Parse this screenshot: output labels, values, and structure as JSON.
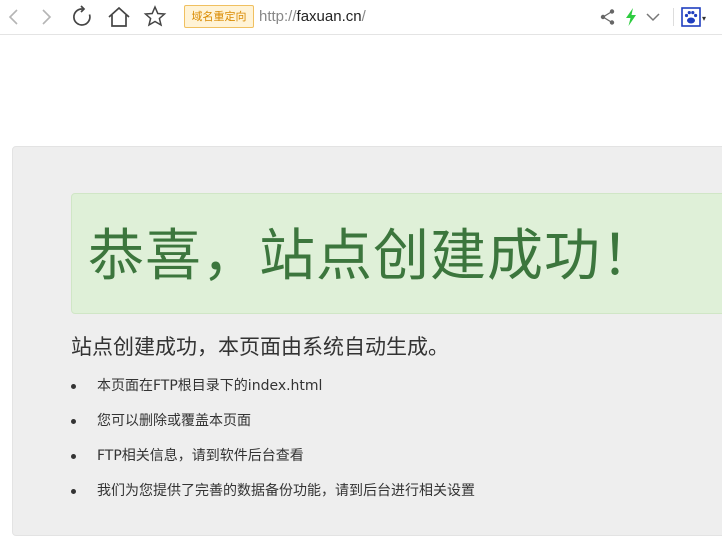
{
  "browser": {
    "redirect_badge": "域名重定向",
    "url": {
      "protocol": "http://",
      "host": "faxuan.cn",
      "path": "/"
    },
    "icons": [
      "back-icon",
      "forward-icon",
      "reload-icon",
      "home-icon",
      "star-icon",
      "share-icon",
      "lightning-icon",
      "chevron-down-icon",
      "paw-icon"
    ]
  },
  "page": {
    "success_title": "恭喜，站点创建成功！",
    "lead": "站点创建成功，本页面由系统自动生成。",
    "items": [
      "本页面在FTP根目录下的index.html",
      "您可以删除或覆盖本页面",
      "FTP相关信息，请到软件后台查看",
      "我们为您提供了完善的数据备份功能，请到后台进行相关设置"
    ]
  },
  "colors": {
    "success_bg": "#dff0d8",
    "success_text": "#3c763d",
    "panel_bg": "#eeeeee",
    "badge_text": "#d98a00",
    "lightning": "#2ecc40",
    "paw": "#1f3fbf"
  }
}
